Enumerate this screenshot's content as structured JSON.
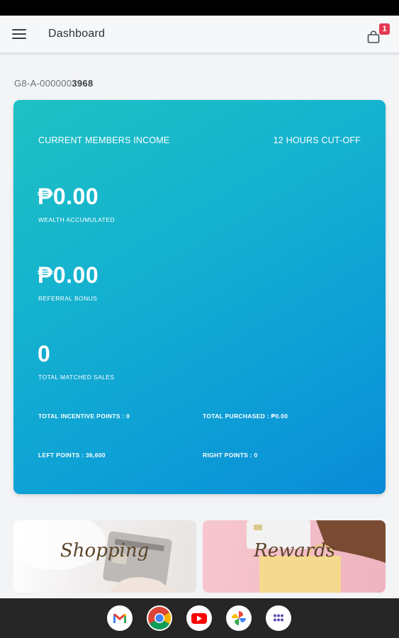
{
  "app_bar": {
    "title": "Dashboard",
    "cart_count": "1"
  },
  "member": {
    "id_prefix": "G8-A-000000",
    "id_suffix": "3968"
  },
  "income_card": {
    "header_left": "CURRENT MEMBERS INCOME",
    "header_right": "12 HOURS CUT-OFF",
    "wealth_value": "₱0.00",
    "wealth_label": "WEALTH ACCUMULATED",
    "referral_value": "₱0.00",
    "referral_label": "REFERRAL BONUS",
    "matched_value": "0",
    "matched_label": "TOTAL MATCHED SALES",
    "incentive_points": "TOTAL INCENTIVE POINTS : 0",
    "total_purchased": "TOTAL PURCHASED : ₱0.00",
    "left_points": "LEFT POINTS : 36,600",
    "right_points": "RIGHT POINTS : 0",
    "gradient_start": "#1fc1c3",
    "gradient_end": "#0a8bd8"
  },
  "promos": {
    "shopping_label": "Shopping",
    "rewards_label": "Rewards"
  },
  "dock": {
    "apps": [
      "gmail-icon",
      "chrome-icon",
      "youtube-icon",
      "photos-icon",
      "app-drawer-icon"
    ]
  },
  "colors": {
    "badge": "#e53a52",
    "app_bar_bg": "#f6f7f9"
  }
}
